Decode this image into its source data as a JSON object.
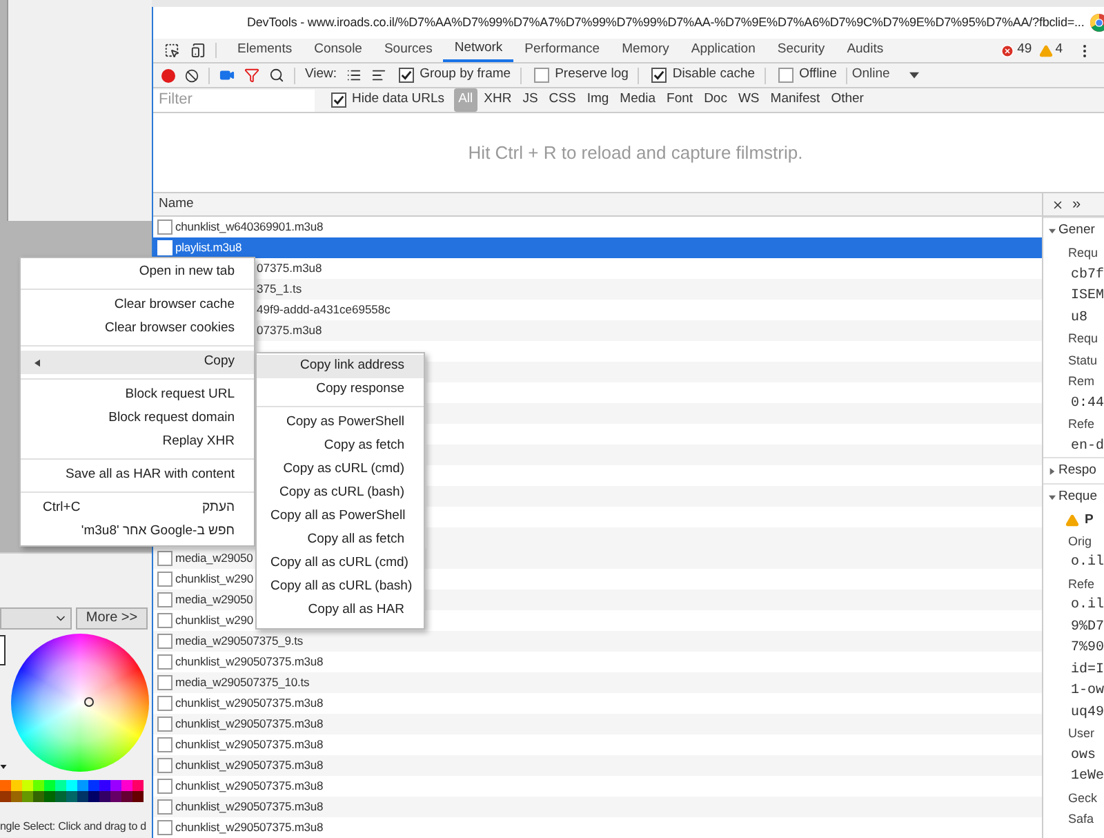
{
  "desktop": {
    "color_picker": {
      "more_button": "More >>",
      "status": "ngle Select: Click and drag to d"
    }
  },
  "window": {
    "title": "DevTools - www.iroads.co.il/%D7%AA%D7%99%D7%A7%D7%99%D7%99%D7%AA-%D7%9E%D7%A6%D7%9C%D7%9E%D7%95%D7%AA/?fbclid=..."
  },
  "tabs": [
    {
      "label": "Elements",
      "selected": false
    },
    {
      "label": "Console",
      "selected": false
    },
    {
      "label": "Sources",
      "selected": false
    },
    {
      "label": "Network",
      "selected": true
    },
    {
      "label": "Performance",
      "selected": false
    },
    {
      "label": "Memory",
      "selected": false
    },
    {
      "label": "Application",
      "selected": false
    },
    {
      "label": "Security",
      "selected": false
    },
    {
      "label": "Audits",
      "selected": false
    }
  ],
  "counts": {
    "errors": "49",
    "warnings": "4"
  },
  "toolbar": {
    "view_label": "View:",
    "options": [
      {
        "label": "Group by frame",
        "checked": true
      },
      {
        "label": "Preserve log",
        "checked": false
      },
      {
        "label": "Disable cache",
        "checked": true
      },
      {
        "label": "Offline",
        "checked": false
      }
    ],
    "throttle": "Online"
  },
  "filter": {
    "placeholder": "Filter",
    "hide_data_urls": {
      "label": "Hide data URLs",
      "checked": true
    },
    "types": [
      {
        "label": "All",
        "selected": true
      },
      {
        "label": "XHR",
        "selected": false
      },
      {
        "label": "JS",
        "selected": false
      },
      {
        "label": "CSS",
        "selected": false
      },
      {
        "label": "Img",
        "selected": false
      },
      {
        "label": "Media",
        "selected": false
      },
      {
        "label": "Font",
        "selected": false
      },
      {
        "label": "Doc",
        "selected": false
      },
      {
        "label": "WS",
        "selected": false
      },
      {
        "label": "Manifest",
        "selected": false
      },
      {
        "label": "Other",
        "selected": false
      }
    ]
  },
  "filmstrip_hint": "Hit Ctrl + R to reload and capture filmstrip.",
  "table": {
    "column": "Name",
    "rows": [
      {
        "kind": "full",
        "name": "chunklist_w640369901.m3u8",
        "selected": false
      },
      {
        "kind": "full",
        "name": "playlist.m3u8",
        "selected": true
      },
      {
        "kind": "tail",
        "name": "07375.m3u8",
        "selected": false
      },
      {
        "kind": "tail",
        "name": "375_1.ts",
        "selected": false
      },
      {
        "kind": "tail",
        "name": "49f9-addd-a431ce69558c",
        "selected": false
      },
      {
        "kind": "tail",
        "name": "07375.m3u8",
        "selected": false
      },
      {
        "kind": "covered"
      },
      {
        "kind": "full",
        "name": "media_w29050",
        "selected": false
      },
      {
        "kind": "full",
        "name": "chunklist_w290",
        "selected": false
      },
      {
        "kind": "full",
        "name": "media_w29050",
        "selected": false
      },
      {
        "kind": "full",
        "name": "chunklist_w290",
        "selected": false
      },
      {
        "kind": "full",
        "name": "media_w290507375_9.ts",
        "selected": false
      },
      {
        "kind": "full",
        "name": "chunklist_w290507375.m3u8",
        "selected": false
      },
      {
        "kind": "full",
        "name": "media_w290507375_10.ts",
        "selected": false
      },
      {
        "kind": "full",
        "name": "chunklist_w290507375.m3u8",
        "selected": false
      },
      {
        "kind": "full",
        "name": "chunklist_w290507375.m3u8",
        "selected": false
      },
      {
        "kind": "full",
        "name": "chunklist_w290507375.m3u8",
        "selected": false
      },
      {
        "kind": "full",
        "name": "chunklist_w290507375.m3u8",
        "selected": false
      },
      {
        "kind": "full",
        "name": "chunklist_w290507375.m3u8",
        "selected": false
      },
      {
        "kind": "full",
        "name": "chunklist_w290507375.m3u8",
        "selected": false
      },
      {
        "kind": "full",
        "name": "chunklist_w290507375.m3u8",
        "selected": false
      }
    ]
  },
  "details_header": {
    "more": "»"
  },
  "details": [
    {
      "kind": "section",
      "label": "Gener",
      "expanded": true
    },
    {
      "kind": "key",
      "label": "Requ"
    },
    {
      "kind": "value",
      "label": "cb7f"
    },
    {
      "kind": "value",
      "label": "ISEM"
    },
    {
      "kind": "value",
      "label": "u8"
    },
    {
      "kind": "key",
      "label": "Requ"
    },
    {
      "kind": "key",
      "label": "Statu"
    },
    {
      "kind": "key",
      "label": "Rem"
    },
    {
      "kind": "value",
      "label": "0:44"
    },
    {
      "kind": "key",
      "label": "Refe"
    },
    {
      "kind": "value",
      "label": "en-d"
    },
    {
      "kind": "section",
      "label": "Respo",
      "expanded": false
    },
    {
      "kind": "section",
      "label": "Reque",
      "expanded": true
    },
    {
      "kind": "warning",
      "label": "P"
    },
    {
      "kind": "key",
      "label": "Orig"
    },
    {
      "kind": "value",
      "label": "o.il"
    },
    {
      "kind": "key",
      "label": "Refe"
    },
    {
      "kind": "value",
      "label": "o.il"
    },
    {
      "kind": "value",
      "label": "9%D7"
    },
    {
      "kind": "value",
      "label": "7%90"
    },
    {
      "kind": "value",
      "label": "id=I"
    },
    {
      "kind": "value",
      "label": "1-ow"
    },
    {
      "kind": "value",
      "label": "uq49"
    },
    {
      "kind": "key",
      "label": "User"
    },
    {
      "kind": "value",
      "label": "ows"
    },
    {
      "kind": "value",
      "label": "1eWe"
    },
    {
      "kind": "key",
      "label": "Geck"
    },
    {
      "kind": "key",
      "label": "Safa"
    }
  ],
  "context_menu": {
    "groups": [
      [
        {
          "kind": "item",
          "label": "Open in new tab",
          "highlighted": false
        }
      ],
      [
        {
          "kind": "item",
          "label": "Clear browser cache",
          "highlighted": false
        },
        {
          "kind": "item",
          "label": "Clear browser cookies",
          "highlighted": false
        }
      ],
      [
        {
          "kind": "submenu",
          "label": "Copy",
          "highlighted": true
        }
      ],
      [
        {
          "kind": "item",
          "label": "Block request URL",
          "highlighted": false
        },
        {
          "kind": "item",
          "label": "Block request domain",
          "highlighted": false
        },
        {
          "kind": "item",
          "label": "Replay XHR",
          "highlighted": false
        }
      ],
      [
        {
          "kind": "item",
          "label": "Save all as HAR with content",
          "highlighted": false
        }
      ],
      [
        {
          "kind": "item",
          "label": "העתק",
          "shortcut": "Ctrl+C",
          "highlighted": false
        },
        {
          "kind": "item",
          "label": "חפש ב-Google אחר 'm3u8'",
          "highlighted": false
        }
      ]
    ],
    "submenu": [
      [
        {
          "label": "Copy link address",
          "highlighted": true
        },
        {
          "label": "Copy response",
          "highlighted": false
        }
      ],
      [
        {
          "label": "Copy as PowerShell",
          "highlighted": false
        },
        {
          "label": "Copy as fetch",
          "highlighted": false
        },
        {
          "label": "Copy as cURL (cmd)",
          "highlighted": false
        },
        {
          "label": "Copy as cURL (bash)",
          "highlighted": false
        },
        {
          "label": "Copy all as PowerShell",
          "highlighted": false
        },
        {
          "label": "Copy all as fetch",
          "highlighted": false
        },
        {
          "label": "Copy all as cURL (cmd)",
          "highlighted": false
        },
        {
          "label": "Copy all as cURL (bash)",
          "highlighted": false
        },
        {
          "label": "Copy all as HAR",
          "highlighted": false
        }
      ]
    ]
  }
}
